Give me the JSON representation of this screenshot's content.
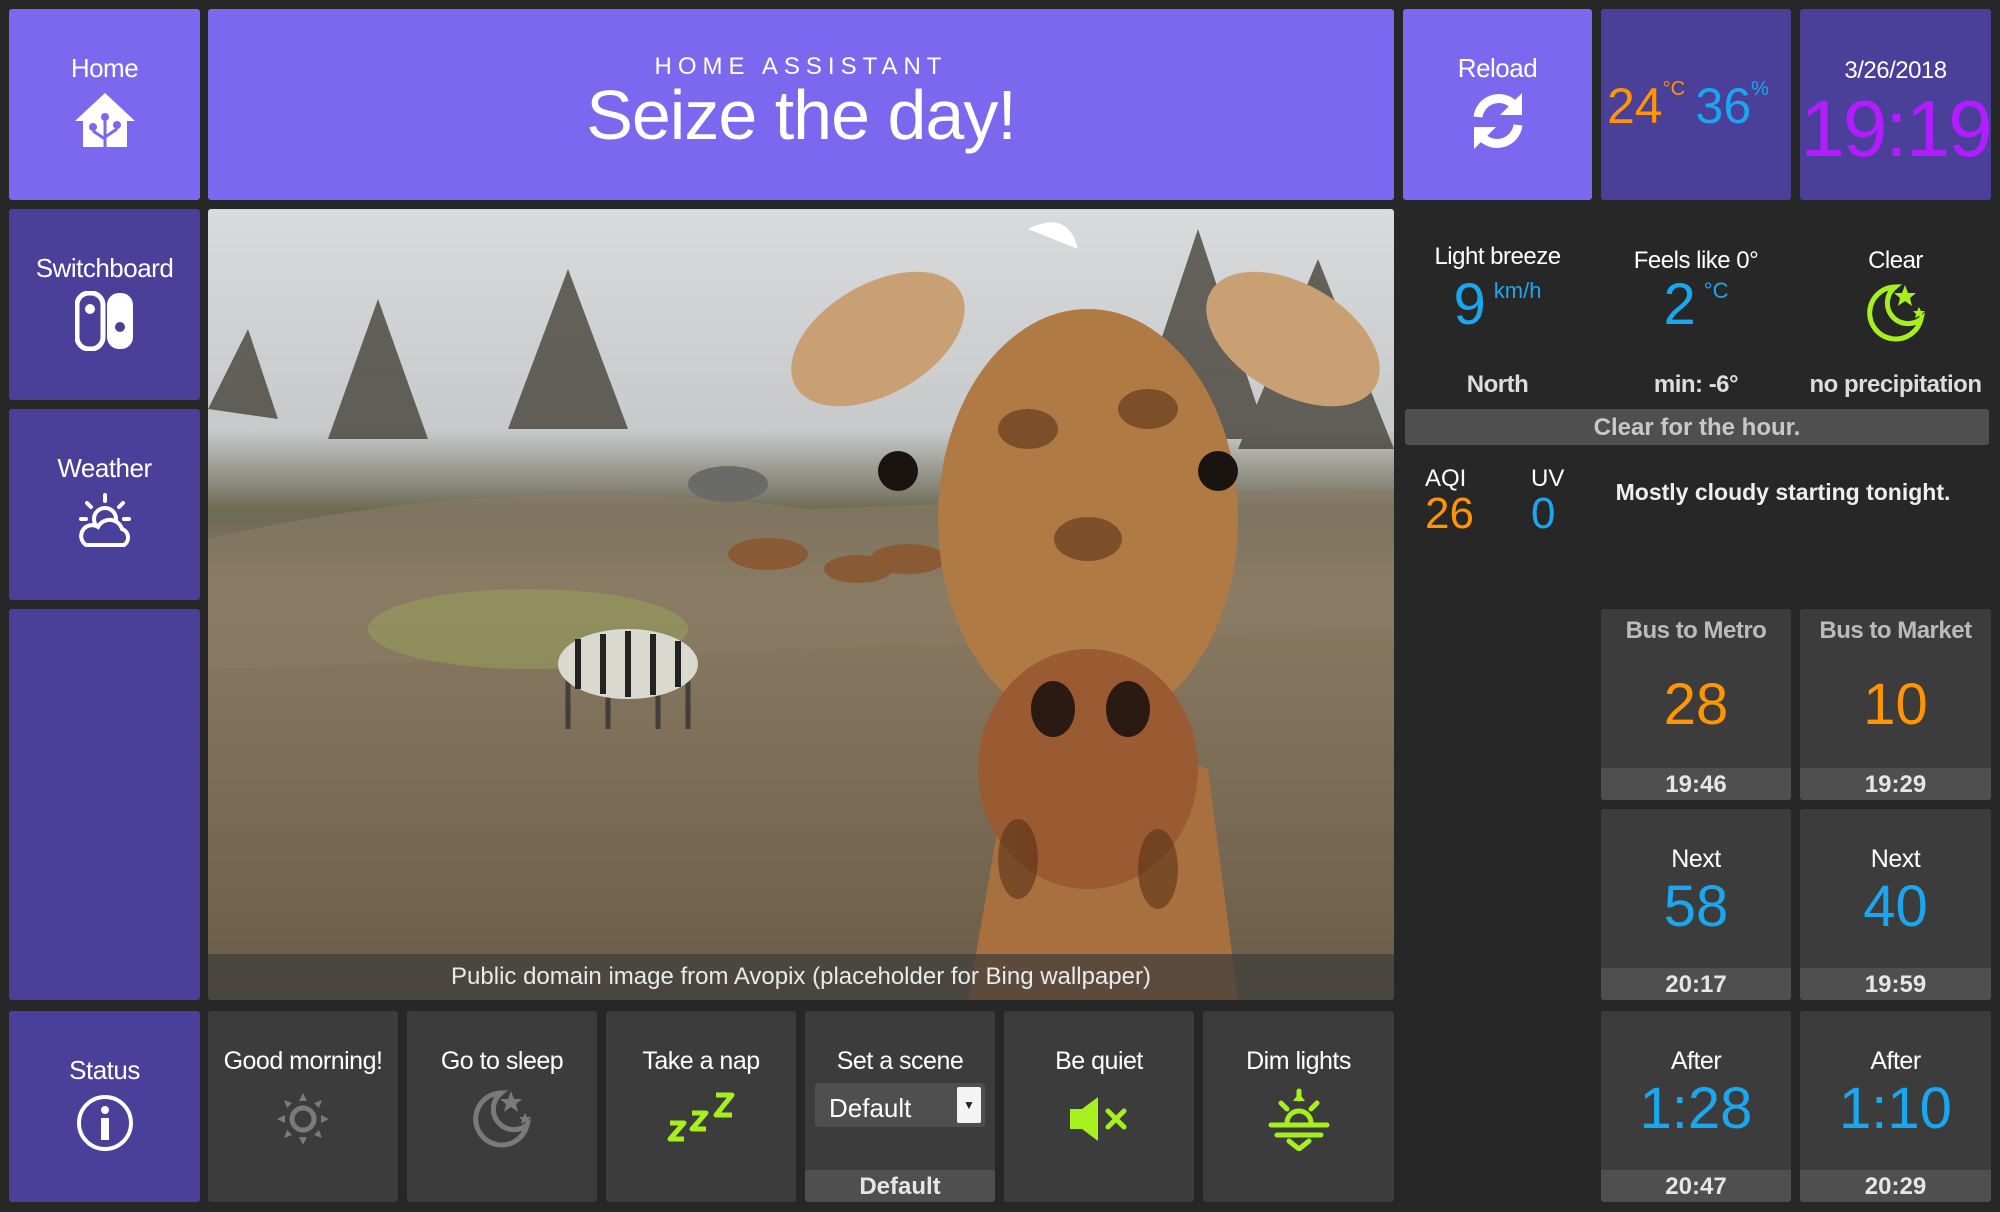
{
  "nav": {
    "home": "Home",
    "switchboard": "Switchboard",
    "weather": "Weather",
    "status": "Status"
  },
  "header": {
    "overline": "HOME ASSISTANT",
    "title": "Seize the day!"
  },
  "reload": {
    "label": "Reload"
  },
  "climate": {
    "temp": "24",
    "temp_unit": "°C",
    "humidity": "36",
    "humidity_unit": "%"
  },
  "clock": {
    "date": "3/26/2018",
    "time": "19:19"
  },
  "weather": {
    "wind_label": "Light breeze",
    "wind_value": "9",
    "wind_unit": "km/h",
    "wind_dir": "North",
    "feels_label": "Feels like 0°",
    "feels_value": "2",
    "feels_unit": "°C",
    "feels_min": "min: -6°",
    "cond_label": "Clear",
    "cond_precip": "no precipitation",
    "hour_summary": "Clear for the hour.",
    "aqi_label": "AQI",
    "aqi_value": "26",
    "uv_label": "UV",
    "uv_value": "0",
    "day_summary": "Mostly cloudy starting tonight."
  },
  "photo": {
    "caption": "Public domain image from Avopix (placeholder for Bing wallpaper)"
  },
  "buses": {
    "metro": {
      "title": "Bus to Metro",
      "minutes": "28",
      "time": "19:46"
    },
    "market": {
      "title": "Bus to Market",
      "minutes": "10",
      "time": "19:29"
    },
    "metro_next": {
      "title": "Next",
      "minutes": "58",
      "time": "20:17"
    },
    "market_next": {
      "title": "Next",
      "minutes": "40",
      "time": "19:59"
    },
    "metro_after": {
      "title": "After",
      "minutes": "1:28",
      "time": "20:47"
    },
    "market_after": {
      "title": "After",
      "minutes": "1:10",
      "time": "20:29"
    }
  },
  "scenes": {
    "good_morning": "Good morning!",
    "go_to_sleep": "Go to sleep",
    "take_a_nap": "Take a nap",
    "set_a_scene": "Set a scene",
    "scene_selected": "Default",
    "scene_status": "Default",
    "be_quiet": "Be quiet",
    "dim_lights": "Dim lights"
  },
  "colors": {
    "accent": "#7b68ee",
    "dark_accent": "#4a3f99",
    "orange": "#ff9500",
    "blue": "#1aa7f0",
    "lime": "#a6f01e",
    "magenta": "#b31cff"
  }
}
